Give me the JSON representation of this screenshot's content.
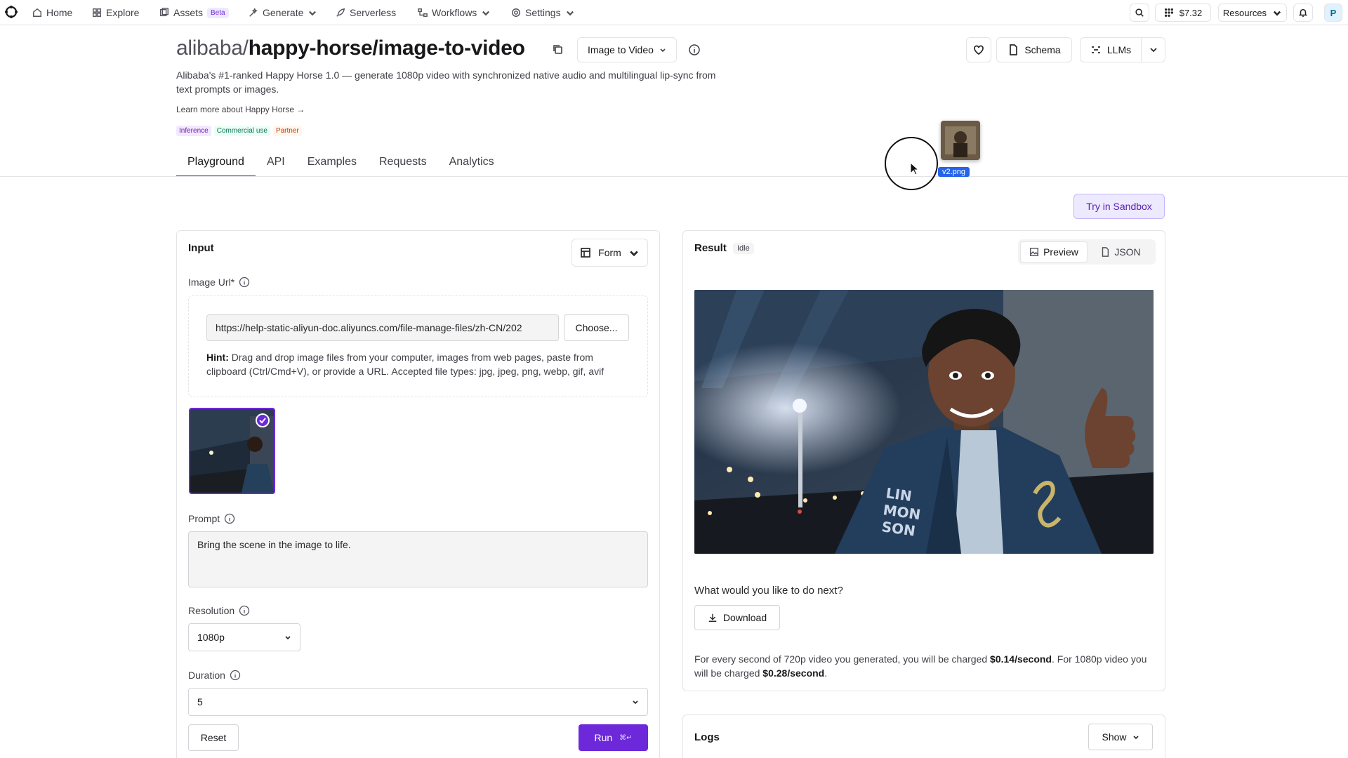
{
  "nav": {
    "home": "Home",
    "explore": "Explore",
    "assets": "Assets",
    "assets_badge": "Beta",
    "generate": "Generate",
    "serverless": "Serverless",
    "workflows": "Workflows",
    "settings": "Settings",
    "balance": "$7.32",
    "resources": "Resources",
    "avatar_initial": "P"
  },
  "header": {
    "owner": "alibaba/",
    "model_name": "happy-horse/image-to-video",
    "mode": "Image to Video",
    "description": "Alibaba's #1-ranked Happy Horse 1.0 — generate 1080p video with synchronized native audio and multilingual lip-sync from text prompts or images.",
    "learn_more": "Learn more about Happy Horse →",
    "tags": [
      "Inference",
      "Commercial use",
      "Partner"
    ],
    "schema_label": "Schema",
    "llms_label": "LLMs"
  },
  "tabs": [
    "Playground",
    "API",
    "Examples",
    "Requests",
    "Analytics"
  ],
  "active_tab": "Playground",
  "drag": {
    "file_label": "v2.png"
  },
  "sandbox_label": "Try in Sandbox",
  "input": {
    "title": "Input",
    "format": "Form",
    "image_url_label": "Image Url*",
    "image_url_value": "https://help-static-aliyun-doc.aliyuncs.com/file-manage-files/zh-CN/202",
    "choose_label": "Choose...",
    "hint_bold": "Hint:",
    "hint_text": "Drag and drop image files from your computer, images from web pages, paste from clipboard (Ctrl/Cmd+V), or provide a URL. Accepted file types: jpg, jpeg, png, webp, gif, avif",
    "prompt_label": "Prompt",
    "prompt_value": "Bring the scene in the image to life.",
    "resolution_label": "Resolution",
    "resolution_value": "1080p",
    "duration_label": "Duration",
    "duration_value": "5",
    "reset_label": "Reset",
    "run_label": "Run",
    "run_shortcut": "⌘↵"
  },
  "result": {
    "title": "Result",
    "status": "Idle",
    "preview_label": "Preview",
    "json_label": "JSON",
    "next_question": "What would you like to do next?",
    "download_label": "Download",
    "pricing_1": "For every second of 720p video you generated, you will be charged ",
    "price_720": "$0.14/second",
    "pricing_2": ". For 1080p video you will be charged ",
    "price_1080": "$0.28/second",
    "pricing_3": "."
  },
  "logs": {
    "title": "Logs",
    "show_label": "Show"
  },
  "colors": {
    "accent": "#6d28d9",
    "accent_soft": "#ede9fe",
    "drag_label": "#2563eb"
  }
}
